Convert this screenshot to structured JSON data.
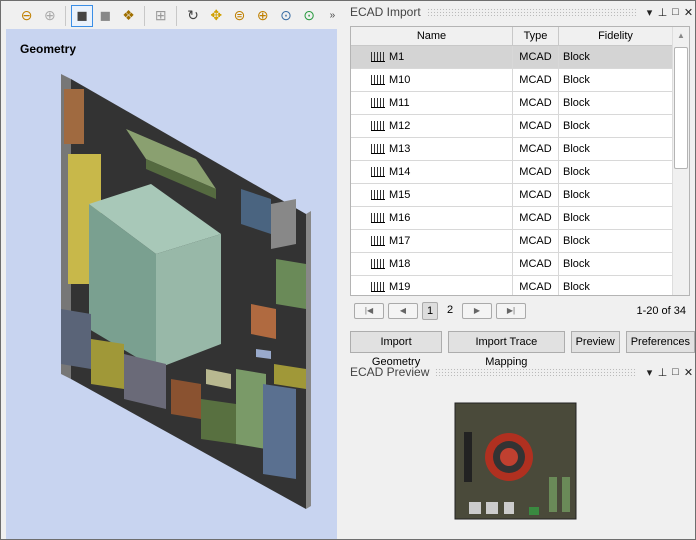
{
  "toolbar": {
    "icons": [
      "zoom-previous-icon",
      "zoom-next-icon",
      "shaded-view-icon",
      "solid-view-icon",
      "visibility-icon",
      "layout-icon",
      "rotate-icon",
      "pan-icon",
      "zoom-fit-icon",
      "zoom-in-icon",
      "zoom-box-icon",
      "zoom-selection-icon",
      "overflow-icon"
    ]
  },
  "viewport": {
    "label": "Geometry",
    "background": "#c8d4f0"
  },
  "import_panel": {
    "title": "ECAD Import",
    "columns": [
      "Name",
      "Type",
      "Fidelity"
    ],
    "rows": [
      {
        "name": "M1",
        "type": "MCAD",
        "fidelity": "Block"
      },
      {
        "name": "M10",
        "type": "MCAD",
        "fidelity": "Block"
      },
      {
        "name": "M11",
        "type": "MCAD",
        "fidelity": "Block"
      },
      {
        "name": "M12",
        "type": "MCAD",
        "fidelity": "Block"
      },
      {
        "name": "M13",
        "type": "MCAD",
        "fidelity": "Block"
      },
      {
        "name": "M14",
        "type": "MCAD",
        "fidelity": "Block"
      },
      {
        "name": "M15",
        "type": "MCAD",
        "fidelity": "Block"
      },
      {
        "name": "M16",
        "type": "MCAD",
        "fidelity": "Block"
      },
      {
        "name": "M17",
        "type": "MCAD",
        "fidelity": "Block"
      },
      {
        "name": "M18",
        "type": "MCAD",
        "fidelity": "Block"
      },
      {
        "name": "M19",
        "type": "MCAD",
        "fidelity": "Block"
      }
    ],
    "pager": {
      "pages": [
        "1",
        "2"
      ],
      "current": "1",
      "count": "1-20 of 34"
    },
    "buttons": {
      "import_geometry": "Import Geometry",
      "import_trace": "Import Trace Mapping",
      "preview": "Preview",
      "preferences": "Preferences"
    }
  },
  "preview_panel": {
    "title": "ECAD Preview"
  }
}
